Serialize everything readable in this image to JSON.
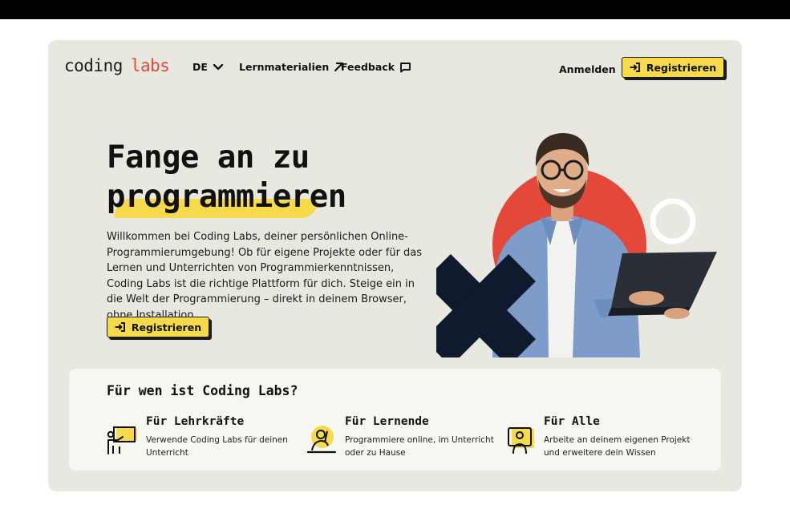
{
  "header": {
    "logo_word1": "coding",
    "logo_word2": "labs",
    "language": "DE",
    "nav_learning": "Lernmaterialien",
    "nav_feedback": "Feedback",
    "login": "Anmelden",
    "register": "Registrieren"
  },
  "hero": {
    "title_line1": "Fange an zu",
    "title_line2": "programmieren",
    "text": "Willkommen bei Coding Labs, deiner persönlichen Online-Programmierumgebung! Ob für eigene Projekte oder für das Lernen und Unterrichten von Programmierkenntnissen, Coding Labs ist die richtige Plattform für dich. Steige ein in die Welt der Programmierung – direkt in deinem Browser, ohne Installation.",
    "cta": "Registrieren"
  },
  "audience": {
    "title": "Für wen ist Coding Labs?",
    "items": [
      {
        "title": "Für Lehrkräfte",
        "desc": "Verwende Coding Labs für deinen Unterricht",
        "icon": "teacher-icon"
      },
      {
        "title": "Für Lernende",
        "desc": "Programmiere online, im Unterricht oder zu Hause",
        "icon": "learner-icon"
      },
      {
        "title": "Für Alle",
        "desc": "Arbeite an deinem eigenen Projekt und erweitere dein Wissen",
        "icon": "everyone-icon"
      }
    ]
  },
  "colors": {
    "accent_yellow": "#f7d94c",
    "accent_red": "#e4483b",
    "navy": "#0f1a2e",
    "card_background": "#e9e8e0"
  }
}
